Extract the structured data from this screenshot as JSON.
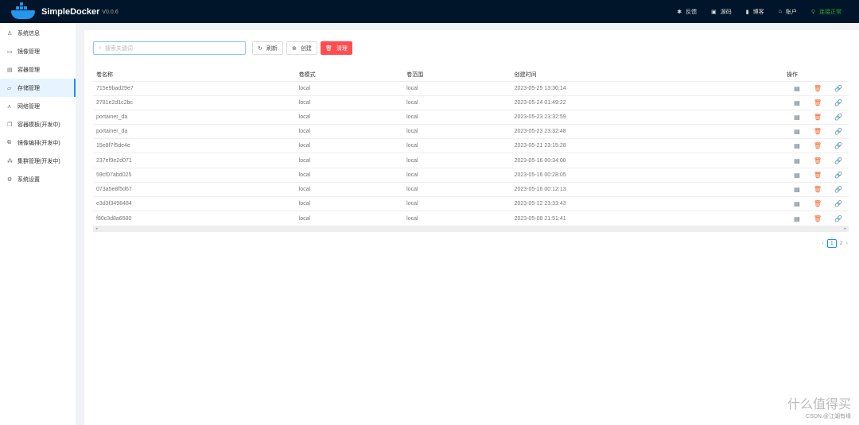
{
  "header": {
    "brand": "SimpleDocker",
    "version": "V0.0.6",
    "nav": [
      {
        "icon": "bug-icon",
        "label": "反馈"
      },
      {
        "icon": "code-icon",
        "label": "源码"
      },
      {
        "icon": "doc-icon",
        "label": "博客"
      },
      {
        "icon": "home-icon",
        "label": "账户"
      },
      {
        "icon": "link-icon",
        "label": "连接正常"
      }
    ]
  },
  "sidebar": {
    "items": [
      {
        "label": "系统信息",
        "icon": "user-icon"
      },
      {
        "label": "镜像管理",
        "icon": "laptop-icon"
      },
      {
        "label": "容器管理",
        "icon": "container-icon"
      },
      {
        "label": "存储管理",
        "icon": "folder-icon"
      },
      {
        "label": "网络管理",
        "icon": "network-icon"
      },
      {
        "label": "容器模板(开发中)",
        "icon": "copy-icon"
      },
      {
        "label": "镜像编排(开发中)",
        "icon": "layers-icon"
      },
      {
        "label": "集群管理(开发中)",
        "icon": "cluster-icon"
      },
      {
        "label": "系统设置",
        "icon": "gear-icon"
      }
    ],
    "active": 3
  },
  "toolbar": {
    "search_placeholder": "搜索关键词",
    "refresh": "刷新",
    "create": "创建",
    "clean": "清理"
  },
  "table": {
    "columns": [
      "卷名称",
      "卷模式",
      "卷范围",
      "创建时间",
      "操作"
    ],
    "rows": [
      [
        "715e9bad29e7",
        "local",
        "local",
        "2023-05-25 13:30:14"
      ],
      [
        "2781e2d1c2bc",
        "local",
        "local",
        "2023-05-24 01:49:22"
      ],
      [
        "portainer_da",
        "local",
        "local",
        "2023-05-23 23:32:59"
      ],
      [
        "portainer_da",
        "local",
        "local",
        "2023-05-23 23:32:48"
      ],
      [
        "15e8f7f5de4e",
        "local",
        "local",
        "2023-05-21 23:15:28"
      ],
      [
        "237ef9e2d071",
        "local",
        "local",
        "2023-05-16 00:34:08"
      ],
      [
        "59cf07abd025",
        "local",
        "local",
        "2023-05-16 00:28:05"
      ],
      [
        "073a5e8f5d67",
        "local",
        "local",
        "2023-05-16 00:12:13"
      ],
      [
        "e3d3f3498484",
        "local",
        "local",
        "2023-05-12 23:33:43"
      ],
      [
        "f80c3d8a6580",
        "local",
        "local",
        "2023-05-08 21:51:41"
      ]
    ]
  },
  "pagination": {
    "pages": [
      "1",
      "2"
    ],
    "current": "1"
  },
  "watermark": {
    "logo": "什么值得买",
    "credit": "CSDN @江湖有缘"
  },
  "colors": {
    "header": "#001529",
    "accent": "#1890ff",
    "danger": "#ff4d4f",
    "ok": "#2ea82e"
  }
}
